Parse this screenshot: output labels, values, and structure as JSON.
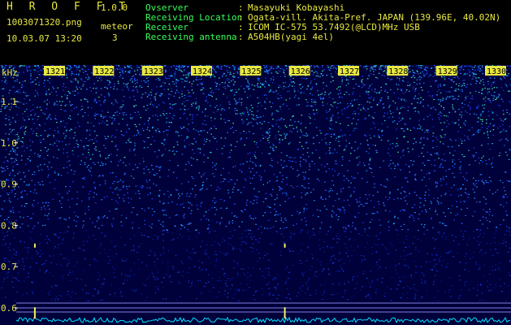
{
  "app": {
    "title": "H R O F F T",
    "version": "1.0.0",
    "file_name": "1003071320.png",
    "date_time": "10.03.07 13:20",
    "meteor_label": "meteor",
    "meteor_count": "3"
  },
  "info": {
    "observer_label": "Ovserver",
    "observer_value": "Masayuki Kobayashi",
    "location_label": "Receiving Location",
    "location_value": "Ogata-vill. Akita-Pref. JAPAN (139.96E, 40.02N)",
    "receiver_label": "Receiver",
    "receiver_value": "ICOM IC-575 53.7492(@LCD)MHz USB",
    "antenna_label": "Receiving antenna",
    "antenna_value": "A504HB(yagi 4el)",
    "colon": ":"
  },
  "spectrogram": {
    "y_unit": "kHz",
    "y_ticks": [
      "1.1",
      "1.0",
      "0.9",
      "0.8",
      "0.7",
      "0.6"
    ],
    "y_tick_values": [
      1.1,
      1.0,
      0.9,
      0.8,
      0.7,
      0.6
    ],
    "x_ticks": [
      "1321",
      "1322",
      "1323",
      "1324",
      "1325",
      "1326",
      "1327",
      "1328",
      "1329",
      "1330"
    ],
    "meteor_echoes": [
      {
        "time": "13:20.6",
        "freq_khz": 0.75
      },
      {
        "time": "13:25.7",
        "freq_khz": 0.75
      },
      {
        "time": "13:20.6",
        "freq_khz": 0.59
      },
      {
        "time": "13:25.7",
        "freq_khz": 0.59
      }
    ],
    "colors": {
      "tick_label_bg": "#e8e840",
      "tick_label_text": "#000000",
      "axis_text": "#e8e840",
      "band_line": "#7f7fe0",
      "trace": "#00e0ff",
      "echo": "#f0f060"
    }
  }
}
